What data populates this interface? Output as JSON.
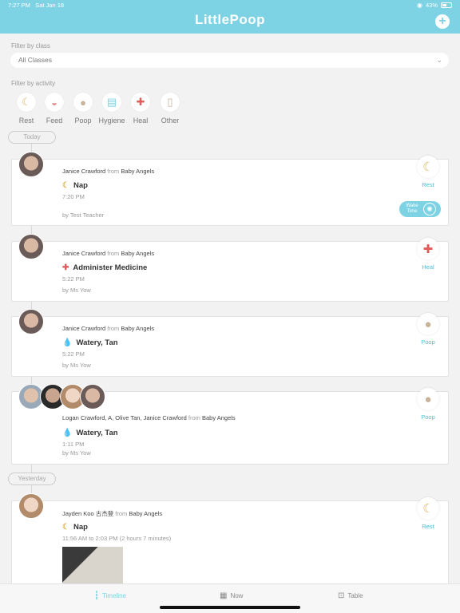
{
  "status_bar": {
    "time": "7:27 PM",
    "date": "Sat Jan 18",
    "battery": "43%"
  },
  "header": {
    "title": "LittlePoop",
    "add_label": "+"
  },
  "filters": {
    "class_label": "Filter by class",
    "class_value": "All Classes",
    "activity_label": "Filter by activity",
    "activities": [
      {
        "label": "Rest",
        "icon": "moon-icon",
        "glyph": "☾"
      },
      {
        "label": "Feed",
        "icon": "bowl-icon",
        "glyph": "◒"
      },
      {
        "label": "Poop",
        "icon": "poop-icon",
        "glyph": "●"
      },
      {
        "label": "Hygiene",
        "icon": "diaper-icon",
        "glyph": "▤"
      },
      {
        "label": "Heal",
        "icon": "medicine-icon",
        "glyph": "✚"
      },
      {
        "label": "Other",
        "icon": "other-icon",
        "glyph": "▯"
      }
    ]
  },
  "dates": {
    "today": "Today",
    "yesterday": "Yesterday"
  },
  "entries": [
    {
      "who": "Janice Crawford",
      "from": "from",
      "class": "Baby Angels",
      "title": "Nap",
      "title_icon": "☾",
      "time": "7:20 PM",
      "by": "by Test Teacher",
      "category": "Rest",
      "cat_icon": "☾",
      "wake_label": "Wake Time"
    },
    {
      "who": "Janice Crawford",
      "from": "from",
      "class": "Baby Angels",
      "title": "Administer Medicine",
      "title_icon": "✚",
      "time": "5:22 PM",
      "by": "by Ms Yow",
      "category": "Heal",
      "cat_icon": "✚"
    },
    {
      "who": "Janice Crawford",
      "from": "from",
      "class": "Baby Angels",
      "title": "Watery, Tan",
      "title_icon": "💧",
      "time": "5:22 PM",
      "by": "by Ms Yow",
      "category": "Poop",
      "cat_icon": "●"
    },
    {
      "who": "Logan Crawford, A, Olive Tan, Janice Crawford",
      "from": "from",
      "class": "Baby Angels",
      "title": "Watery, Tan",
      "title_icon": "💧",
      "time": "1:11 PM",
      "by": "by Ms Yow",
      "category": "Poop",
      "cat_icon": "●"
    },
    {
      "who": "Jayden Koo 古杰登",
      "from": "from",
      "class": "Baby Angels",
      "title": "Nap",
      "title_icon": "☾",
      "time": "11:56 AM to 2:03 PM (2 hours 7 minutes)",
      "category": "Rest",
      "cat_icon": "☾"
    }
  ],
  "tabs": [
    {
      "label": "Timeline",
      "icon": "timeline-icon",
      "glyph": "┇"
    },
    {
      "label": "Now",
      "icon": "grid-icon",
      "glyph": "▦"
    },
    {
      "label": "Table",
      "icon": "table-icon",
      "glyph": "⊡"
    }
  ],
  "colors": {
    "accent": "#7dd3e4",
    "category_text": "#4fbcd6"
  }
}
